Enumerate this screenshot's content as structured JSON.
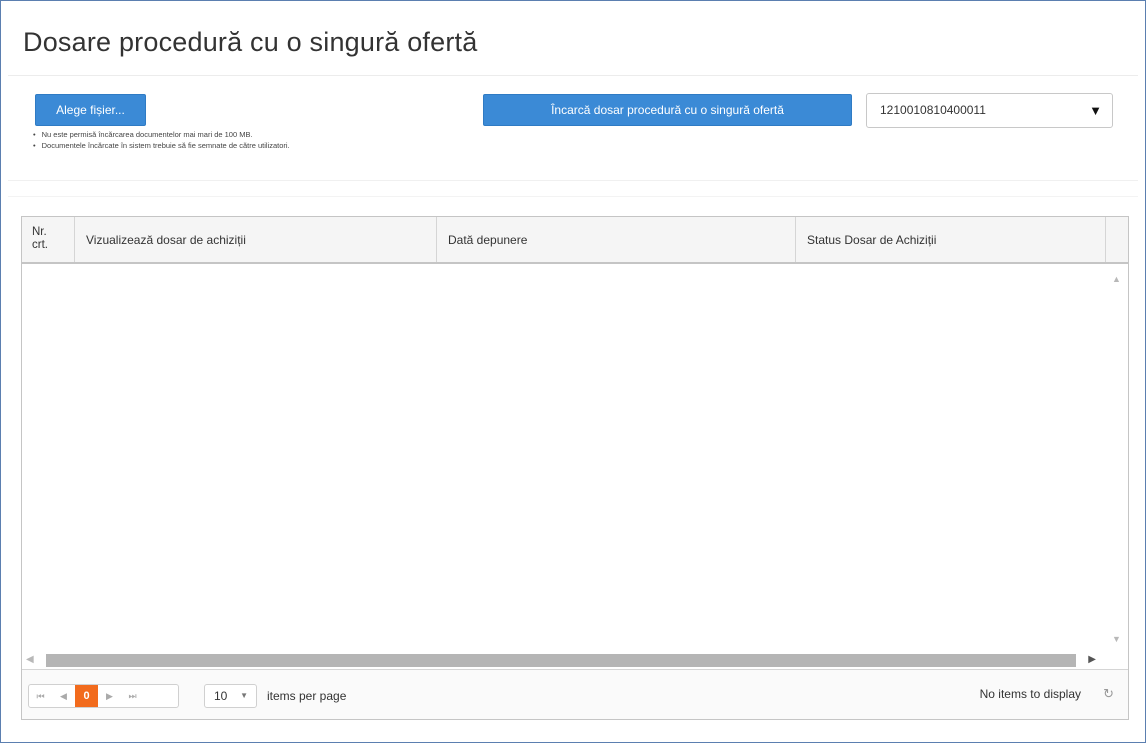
{
  "page": {
    "title": "Dosare procedură cu o singură ofertă"
  },
  "upload": {
    "choose_label": "Alege fișier...",
    "upload_label": "Încarcă dosar procedură cu o singură ofertă",
    "notes": [
      "Nu este permisă încărcarea documentelor mai mari de 100 MB.",
      "Documentele încărcate în sistem trebuie să fie semnate de către utilizatori."
    ]
  },
  "procedure_select": {
    "value": "1210010810400011"
  },
  "grid": {
    "columns": {
      "nr": "Nr. crt.",
      "view": "Vizualizează dosar de achiziții",
      "date": "Dată depunere",
      "status": "Status Dosar de Achiziții"
    },
    "pager": {
      "current_page": "0",
      "page_size": "10",
      "per_page_label": "items per page",
      "no_items": "No items to display"
    }
  },
  "icons": {
    "first": "first-page-icon",
    "prev": "prev-page-icon",
    "next": "next-page-icon",
    "last": "last-page-icon",
    "refresh": "refresh-icon",
    "dropdown": "caret-down-icon"
  },
  "colors": {
    "primary_button": "#3b8ad6",
    "current_page": "#f26b1d"
  }
}
